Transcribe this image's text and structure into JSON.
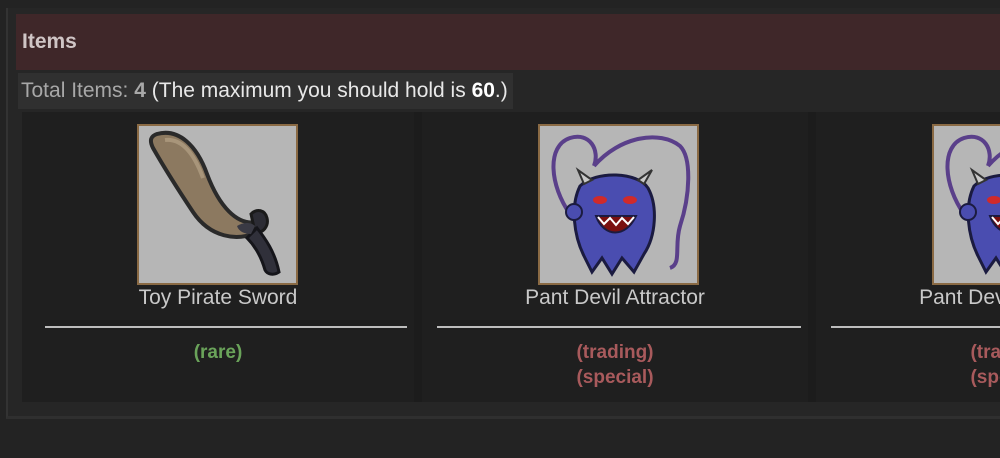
{
  "section": {
    "title": "Items"
  },
  "summary": {
    "total_label": "Total Items:",
    "total_count": "4",
    "paren_prefix": "(The maximum you should hold is",
    "max_count": "60",
    "paren_suffix": ".)"
  },
  "items": [
    {
      "name": "Toy Pirate Sword",
      "image": "pirate-sword-icon",
      "tags": [
        "(rare)"
      ]
    },
    {
      "name": "Pant Devil Attractor",
      "image": "pant-devil-icon",
      "tags": [
        "(trading)",
        "(special)"
      ]
    },
    {
      "name": "Pant Devil Attractor",
      "image": "pant-devil-icon",
      "tags": [
        "(trading)",
        "(special)"
      ]
    }
  ],
  "colors": {
    "header_bg": "#3f2729",
    "tag_rare": "#6aa35a",
    "tag_trading": "#a85a5c",
    "frame": "#8a6a44"
  }
}
